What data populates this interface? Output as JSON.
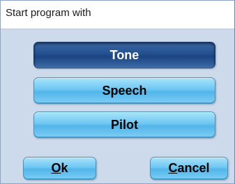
{
  "dialog": {
    "title": "Start program with"
  },
  "choices": {
    "tone": "Tone",
    "speech": "Speech",
    "pilot": "Pilot",
    "selected": "Tone"
  },
  "actions": {
    "ok_mnemonic": "O",
    "ok_rest": "k",
    "cancel_mnemonic": "C",
    "cancel_rest": "ancel"
  },
  "colors": {
    "dialog_background": "#ccdaeb",
    "button_light": "#6ec7f2",
    "button_selected": "#23508f"
  }
}
